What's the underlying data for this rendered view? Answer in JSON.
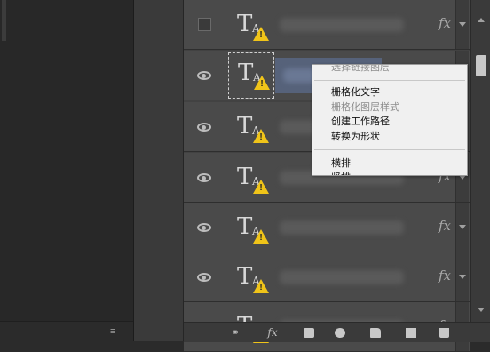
{
  "layers": {
    "rows": [
      {
        "visible": false,
        "selected": false
      },
      {
        "visible": true,
        "selected": true
      },
      {
        "visible": true,
        "selected": false
      },
      {
        "visible": true,
        "selected": false
      },
      {
        "visible": true,
        "selected": false
      },
      {
        "visible": true,
        "selected": false
      },
      {
        "visible": true,
        "selected": false
      }
    ],
    "text_layer_glyph": "T",
    "text_layer_subglyph": "A",
    "warning_mark": "!",
    "fx_label": "fx"
  },
  "context_menu": {
    "items": [
      {
        "label": "选择链接图层",
        "disabled": true
      },
      {
        "label": "栅格化文字",
        "disabled": false
      },
      {
        "label": "栅格化图层样式",
        "disabled": true
      },
      {
        "label": "创建工作路径",
        "disabled": false
      },
      {
        "label": "转换为形状",
        "disabled": false
      },
      {
        "label": "横排",
        "disabled": false
      },
      {
        "label": "竖排",
        "disabled": false
      }
    ]
  },
  "bottom_toolbar": {
    "link_icon": "link-icon",
    "fx_label": "fx",
    "icons": [
      "link-icon",
      "fx-icon",
      "mask-icon",
      "adjustment-icon",
      "folder-icon",
      "new-layer-icon",
      "trash-icon"
    ]
  },
  "left_panel": {
    "menu_icon": "≡"
  },
  "colors": {
    "warning": "#f0c419",
    "selection": "#56627a",
    "panel": "#4a4a4a"
  }
}
